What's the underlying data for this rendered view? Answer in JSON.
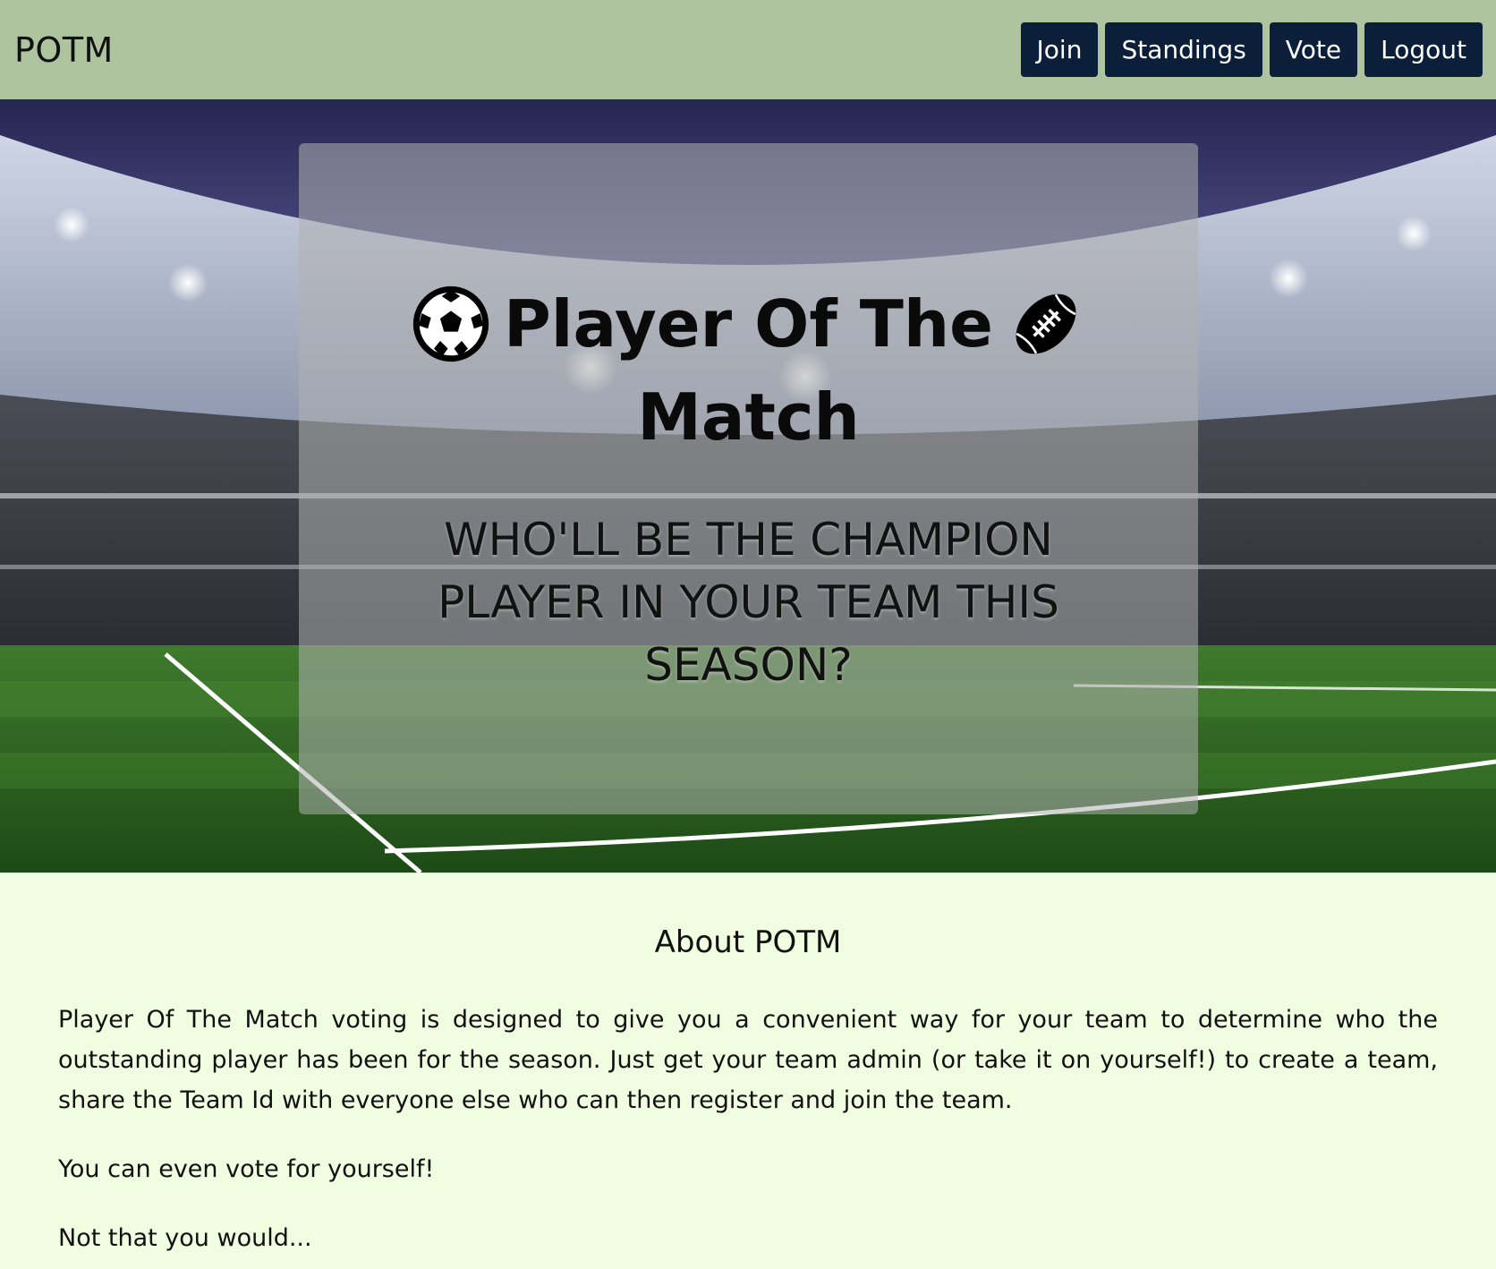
{
  "navbar": {
    "brand": "POTM",
    "buttons": [
      {
        "label": "Join"
      },
      {
        "label": "Standings"
      },
      {
        "label": "Vote"
      },
      {
        "label": "Logout"
      }
    ]
  },
  "hero": {
    "title_line1": "Player Of The",
    "title_line2": "Match",
    "subtitle": "WHO'LL BE THE CHAMPION PLAYER IN YOUR TEAM THIS SEASON?",
    "icons": [
      "soccer-ball-icon",
      "american-football-icon"
    ]
  },
  "about": {
    "heading": "About POTM",
    "paragraphs": [
      "Player Of The Match voting is designed to give you a convenient way for your team to determine who the outstanding player has been for the season. Just get your team admin (or take it on yourself!) to create a team, share the Team Id with everyone else who can then register and join the team.",
      "You can even vote for yourself!",
      "Not that you would..."
    ]
  },
  "colors": {
    "navbar_bg": "#adc49f",
    "button_bg": "#0b1f3a",
    "about_bg": "#f0fde0"
  }
}
